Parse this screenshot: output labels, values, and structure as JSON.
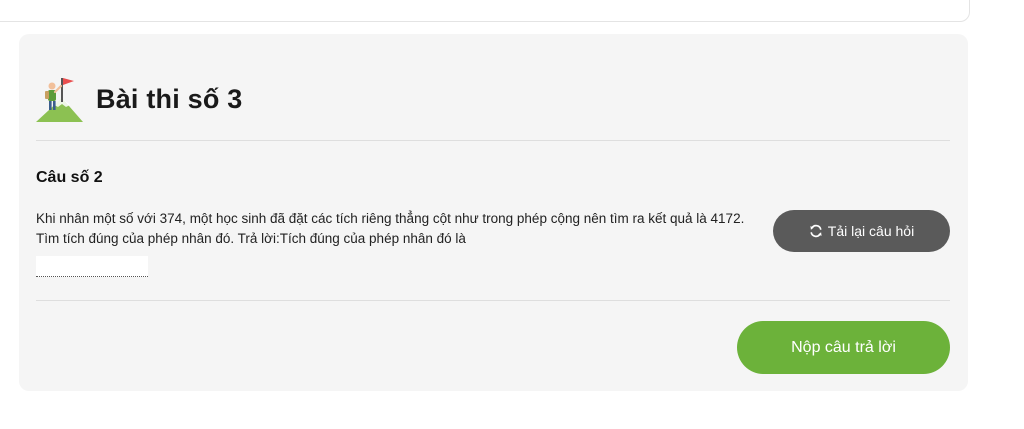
{
  "exam": {
    "title": "Bài thi số 3",
    "icon": "summit-flag-icon"
  },
  "question": {
    "label": "Câu số 2",
    "text": "Khi nhân một số với 374, một học sinh đã đặt các tích riêng thẳng cột như trong phép cộng nên tìm ra kết quả là 4172. Tìm tích đúng của phép nhân đó. Trả lời:Tích đúng của phép nhân đó là",
    "answer_value": ""
  },
  "buttons": {
    "reload_label": "Tải lại câu hỏi",
    "submit_label": "Nộp câu trả lời"
  },
  "colors": {
    "submit_bg": "#6cb23a",
    "reload_bg": "#5a5a5a",
    "panel_bg": "#f5f5f5"
  }
}
